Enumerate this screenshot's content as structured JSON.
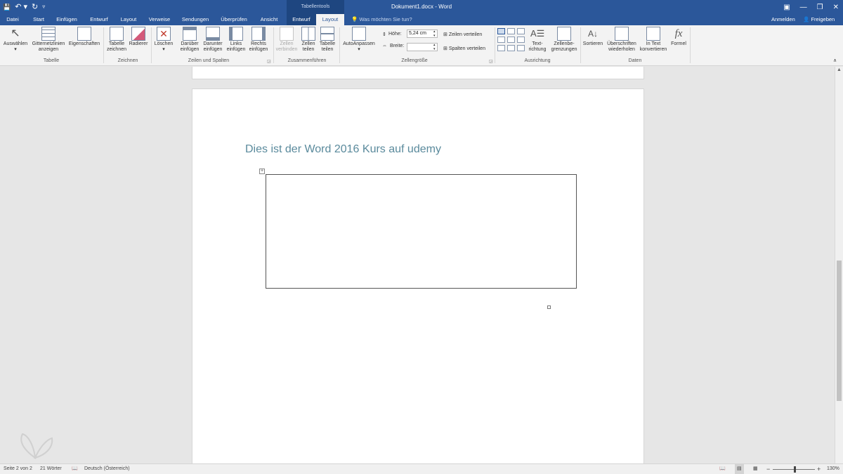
{
  "titlebar": {
    "qat_save": "💾",
    "qat_undo": "↶ ▾",
    "qat_redo": "↻",
    "qat_more": "▿",
    "context_group": "Tabellentools",
    "document_title": "Dokument1.docx - Word",
    "ribbon_display_icon": "▣",
    "minimize_icon": "—",
    "restore_icon": "❐",
    "close_icon": "✕"
  },
  "tabs": {
    "datei": "Datei",
    "start": "Start",
    "einfuegen": "Einfügen",
    "entwurf": "Entwurf",
    "layout": "Layout",
    "verweise": "Verweise",
    "sendungen": "Sendungen",
    "ueberpruefen": "Überprüfen",
    "ansicht": "Ansicht",
    "tbl_entwurf": "Entwurf",
    "tbl_layout": "Layout",
    "tell_me": "Was möchten Sie tun?",
    "anmelden": "Anmelden",
    "freigeben": "Freigeben"
  },
  "ribbon": {
    "auswaehlen": "Auswählen",
    "gitternetzlinien_1": "Gitternetzlinien",
    "gitternetzlinien_2": "anzeigen",
    "eigenschaften": "Eigenschaften",
    "group_tabelle": "Tabelle",
    "tabelle_zeichnen_1": "Tabelle",
    "tabelle_zeichnen_2": "zeichnen",
    "radierer": "Radierer",
    "group_zeichnen": "Zeichnen",
    "loeschen": "Löschen",
    "darueber_1": "Darüber",
    "darueber_2": "einfügen",
    "darunter_1": "Darunter",
    "darunter_2": "einfügen",
    "links_1": "Links",
    "links_2": "einfügen",
    "rechts_1": "Rechts",
    "rechts_2": "einfügen",
    "group_zeilen_spalten": "Zeilen und Spalten",
    "zellen_verbinden_1": "Zellen",
    "zellen_verbinden_2": "verbinden",
    "zellen_teilen_1": "Zellen",
    "zellen_teilen_2": "teilen",
    "tabelle_teilen_1": "Tabelle",
    "tabelle_teilen_2": "teilen",
    "group_zusammenfuehren": "Zusammenführen",
    "autoanpassen": "AutoAnpassen",
    "hoehe_label": "Höhe:",
    "hoehe_value": "5,24 cm",
    "breite_label": "Breite:",
    "breite_value": "",
    "zeilen_verteilen": "Zeilen verteilen",
    "spalten_verteilen": "Spalten verteilen",
    "group_zellengroesse": "Zellengröße",
    "textrichtung_1": "Text-",
    "textrichtung_2": "richtung",
    "zellenbegrenzungen_1": "Zellenbe-",
    "zellenbegrenzungen_2": "grenzungen",
    "group_ausrichtung": "Ausrichtung",
    "sortieren": "Sortieren",
    "ueberschriften_1": "Überschriften",
    "ueberschriften_2": "wiederholen",
    "in_text_1": "In Text",
    "in_text_2": "konvertieren",
    "formel": "Formel",
    "formel_icon": "fx",
    "group_daten": "Daten"
  },
  "document": {
    "heading": "Dies ist der Word 2016 Kurs auf udemy",
    "table_move_handle": "+"
  },
  "statusbar": {
    "page": "Seite 2 von 2",
    "words": "21 Wörter",
    "language": "Deutsch (Österreich)",
    "zoom_minus": "−",
    "zoom_plus": "+",
    "zoom": "130%"
  }
}
